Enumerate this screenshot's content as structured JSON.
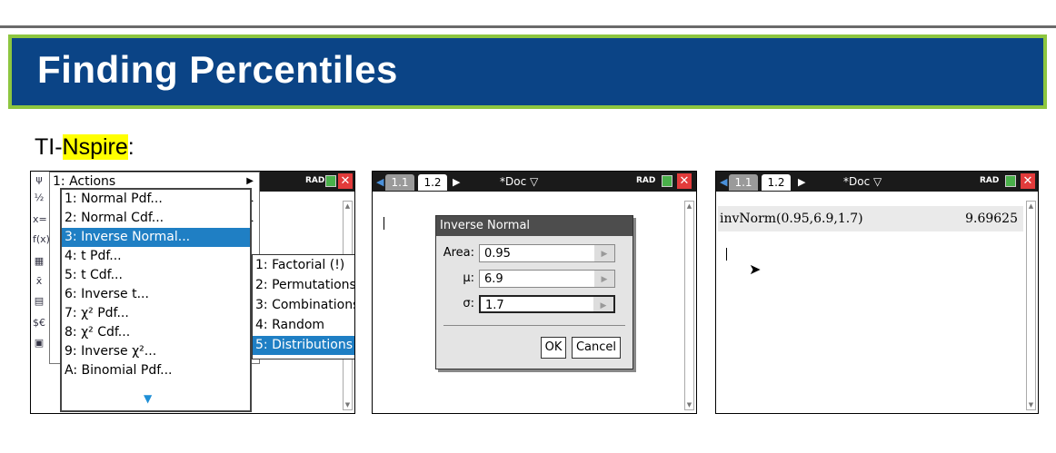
{
  "title": "Finding Percentiles",
  "subtitle": {
    "prefix": "TI-",
    "highlight": "Nspire",
    "suffix": ":"
  },
  "screen1": {
    "rad": "RAD",
    "menu_items": [
      "1: Actions",
      "1: Normal Pdf...",
      "2: Normal Cdf...",
      "3: Inverse Normal...",
      "4: t Pdf...",
      "5: t Cdf...",
      "6: Inverse t...",
      "7: χ² Pdf...",
      "8: χ² Cdf...",
      "9: Inverse χ²...",
      "A: Binomial Pdf..."
    ],
    "submenu_items": [
      "1: Factorial (!)",
      "2: Permutations",
      "3: Combinations",
      "4: Random",
      "5: Distributions"
    ]
  },
  "screen2": {
    "tabs": [
      "1.1",
      "1.2"
    ],
    "doc": "*Doc",
    "rad": "RAD",
    "dialog_title": "Inverse Normal",
    "area_label": "Area:",
    "area_value": "0.95",
    "mu_label": "μ:",
    "mu_value": "6.9",
    "sigma_label": "σ:",
    "sigma_value": "1.7",
    "ok": "OK",
    "cancel": "Cancel"
  },
  "screen3": {
    "tabs": [
      "1.1",
      "1.2"
    ],
    "doc": "*Doc",
    "rad": "RAD",
    "expression": "invNorm(0.95,6.9,1.7)",
    "result": "9.69625"
  }
}
